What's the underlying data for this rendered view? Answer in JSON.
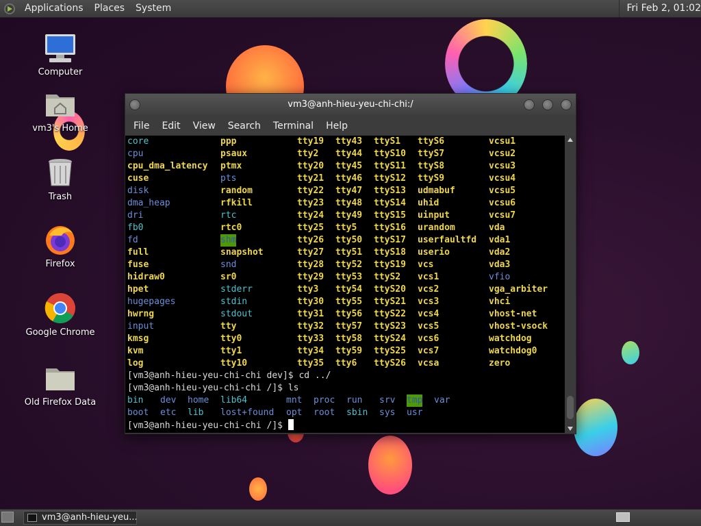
{
  "panel": {
    "menus": [
      "Applications",
      "Places",
      "System"
    ],
    "clock": "Fri Feb  2, 01:02"
  },
  "desktop": {
    "icons": [
      {
        "label": "Computer",
        "icon": "computer-icon"
      },
      {
        "label": "vm3's Home",
        "icon": "home-folder-icon"
      },
      {
        "label": "Trash",
        "icon": "trash-icon"
      },
      {
        "label": "Firefox",
        "icon": "firefox-icon"
      },
      {
        "label": "Google Chrome",
        "icon": "chrome-icon"
      },
      {
        "label": "Old Firefox Data",
        "icon": "folder-icon"
      }
    ]
  },
  "terminal": {
    "title": "vm3@anh-hieu-yeu-chi-chi:/",
    "menu": [
      "File",
      "Edit",
      "View",
      "Search",
      "Terminal",
      "Help"
    ],
    "listing_rows": [
      [
        "core",
        "ppp",
        "tty19",
        "tty43",
        "ttyS1",
        "ttyS6",
        "vcsu1"
      ],
      [
        "cpu",
        "psaux",
        "tty2",
        "tty44",
        "ttyS10",
        "ttyS7",
        "vcsu2"
      ],
      [
        "cpu_dma_latency",
        "ptmx",
        "tty20",
        "tty45",
        "ttyS11",
        "ttyS8",
        "vcsu3"
      ],
      [
        "cuse",
        "pts",
        "tty21",
        "tty46",
        "ttyS12",
        "ttyS9",
        "vcsu4"
      ],
      [
        "disk",
        "random",
        "tty22",
        "tty47",
        "ttyS13",
        "udmabuf",
        "vcsu5"
      ],
      [
        "dma_heap",
        "rfkill",
        "tty23",
        "tty48",
        "ttyS14",
        "uhid",
        "vcsu6"
      ],
      [
        "dri",
        "rtc",
        "tty24",
        "tty49",
        "ttyS15",
        "uinput",
        "vcsu7"
      ],
      [
        "fb0",
        "rtc0",
        "tty25",
        "tty5",
        "ttyS16",
        "urandom",
        "vda"
      ],
      [
        "fd",
        "shm",
        "tty26",
        "tty50",
        "ttyS17",
        "userfaultfd",
        "vda1"
      ],
      [
        "full",
        "snapshot",
        "tty27",
        "tty51",
        "ttyS18",
        "userio",
        "vda2"
      ],
      [
        "fuse",
        "snd",
        "tty28",
        "tty52",
        "ttyS19",
        "vcs",
        "vda3"
      ],
      [
        "hidraw0",
        "sr0",
        "tty29",
        "tty53",
        "ttyS2",
        "vcs1",
        "vfio"
      ],
      [
        "hpet",
        "stderr",
        "tty3",
        "tty54",
        "ttyS20",
        "vcs2",
        "vga_arbiter"
      ],
      [
        "hugepages",
        "stdin",
        "tty30",
        "tty55",
        "ttyS21",
        "vcs3",
        "vhci"
      ],
      [
        "hwrng",
        "stdout",
        "tty31",
        "tty56",
        "ttyS22",
        "vcs4",
        "vhost-net"
      ],
      [
        "input",
        "tty",
        "tty32",
        "tty57",
        "ttyS23",
        "vcs5",
        "vhost-vsock"
      ],
      [
        "kmsg",
        "tty0",
        "tty33",
        "tty58",
        "ttyS24",
        "vcs6",
        "watchdog"
      ],
      [
        "kvm",
        "tty1",
        "tty34",
        "tty59",
        "ttyS25",
        "vcs7",
        "watchdog0"
      ],
      [
        "log",
        "tty10",
        "tty35",
        "tty6",
        "ttyS26",
        "vcsa",
        "zero"
      ]
    ],
    "cmd1": "[vm3@anh-hieu-yeu-chi-chi dev]$ cd ../",
    "cmd2": "[vm3@anh-hieu-yeu-chi-chi /]$ ls",
    "ls_row1": [
      "bin",
      "dev",
      "home",
      "lib64",
      "mnt",
      "proc",
      "run",
      "srv",
      "tmp",
      "var"
    ],
    "ls_row2": [
      "boot",
      "etc",
      "lib",
      "lost+found",
      "opt",
      "root",
      "sbin",
      "sys",
      "usr"
    ],
    "prompt": "[vm3@anh-hieu-yeu-chi-chi /]$ "
  },
  "taskbar": {
    "task_label": "vm3@anh-hieu-yeu..."
  }
}
